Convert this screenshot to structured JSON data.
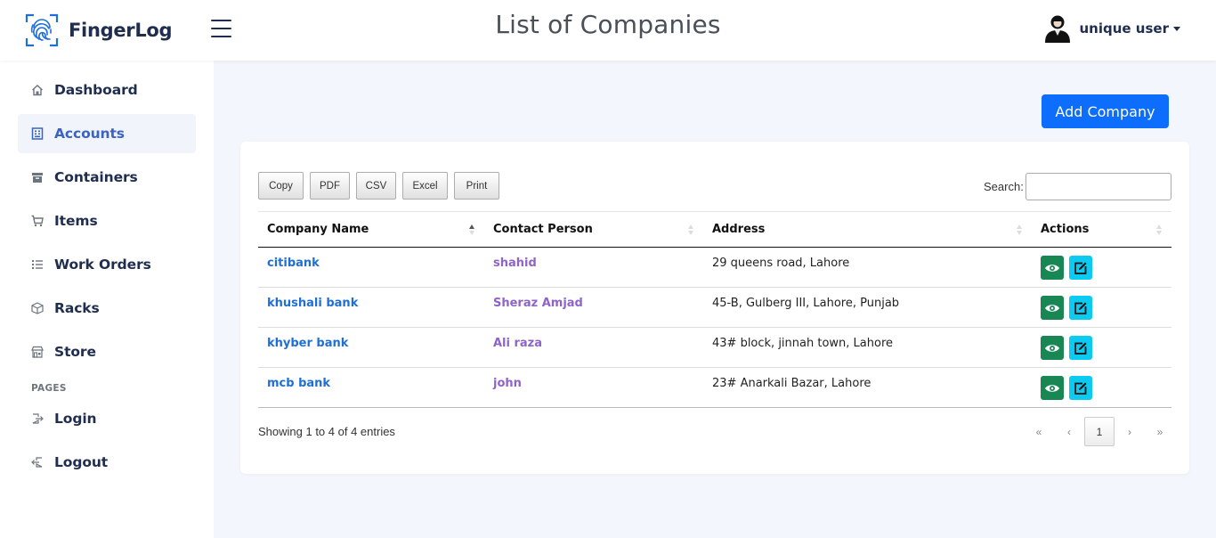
{
  "brand": {
    "name": "FingerLog"
  },
  "header": {
    "title": "List of Companies",
    "user_name": "unique user"
  },
  "sidebar": {
    "items": [
      {
        "label": "Dashboard",
        "icon": "home-icon",
        "active": false
      },
      {
        "label": "Accounts",
        "icon": "building-icon",
        "active": true
      },
      {
        "label": "Containers",
        "icon": "archive-icon",
        "active": false
      },
      {
        "label": "Items",
        "icon": "cart-icon",
        "active": false
      },
      {
        "label": "Work Orders",
        "icon": "list-icon",
        "active": false
      },
      {
        "label": "Racks",
        "icon": "box-icon",
        "active": false
      },
      {
        "label": "Store",
        "icon": "store-icon",
        "active": false
      }
    ],
    "pages_label": "PAGES",
    "pages": [
      {
        "label": "Login",
        "icon": "login-icon"
      },
      {
        "label": "Logout",
        "icon": "logout-icon"
      }
    ]
  },
  "main": {
    "add_button": "Add Company",
    "export_buttons": [
      "Copy",
      "PDF",
      "CSV",
      "Excel",
      "Print"
    ],
    "search_label": "Search:",
    "search_value": "",
    "columns": [
      "Company Name",
      "Contact Person",
      "Address",
      "Actions"
    ],
    "rows": [
      {
        "company": "citibank",
        "contact": "shahid",
        "address": "29 queens road, Lahore"
      },
      {
        "company": "khushali bank",
        "contact": "Sheraz Amjad",
        "address": "45-B, Gulberg III, Lahore, Punjab"
      },
      {
        "company": "khyber bank",
        "contact": "Ali raza",
        "address": "43# block, jinnah town, Lahore"
      },
      {
        "company": "mcb bank",
        "contact": "john",
        "address": "23# Anarkali Bazar, Lahore"
      }
    ],
    "info": "Showing 1 to 4 of 4 entries",
    "pagination": {
      "first": "«",
      "prev": "‹",
      "current": "1",
      "next": "›",
      "last": "»"
    }
  },
  "colors": {
    "primary": "#0d6efd",
    "view_button": "#198754",
    "edit_button": "#0dcaf0",
    "brand_text": "#1f2d4e",
    "company_link": "#1f6fd6",
    "contact_link": "#8f64c9"
  }
}
